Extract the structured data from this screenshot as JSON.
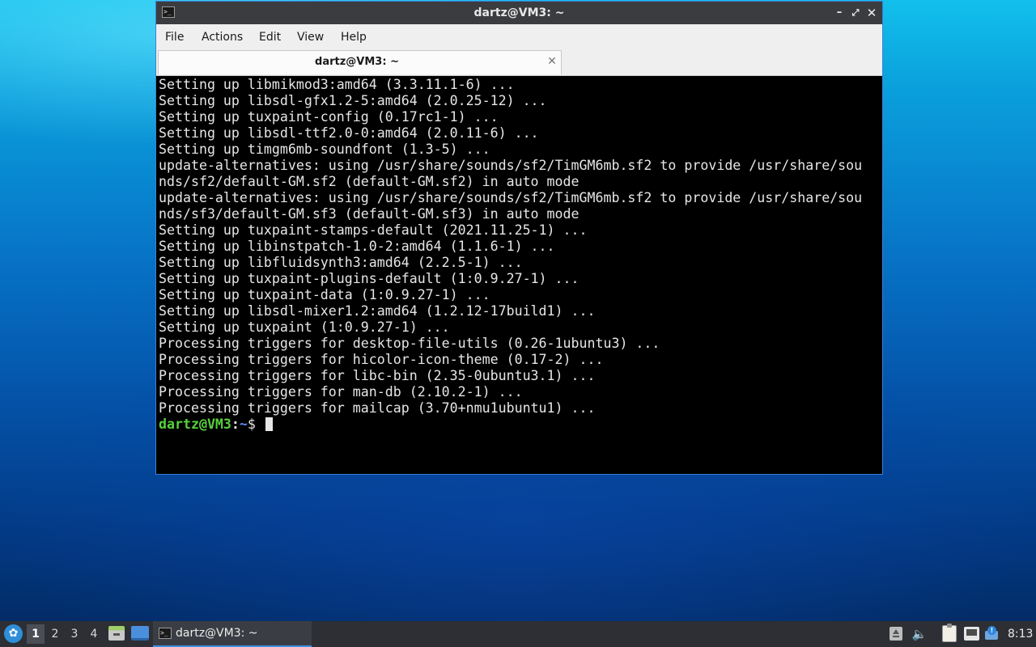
{
  "window": {
    "title": "dartz@VM3: ~",
    "controls": {
      "minimize": "minimize-icon",
      "maximize": "maximize-icon",
      "close": "close-icon"
    }
  },
  "menubar": {
    "items": [
      {
        "label": "File"
      },
      {
        "label": "Actions"
      },
      {
        "label": "Edit"
      },
      {
        "label": "View"
      },
      {
        "label": "Help"
      }
    ]
  },
  "tabs": [
    {
      "label": "dartz@VM3: ~",
      "active": true
    }
  ],
  "terminal": {
    "lines": [
      "Setting up libmikmod3:amd64 (3.3.11.1-6) ...",
      "Setting up libsdl-gfx1.2-5:amd64 (2.0.25-12) ...",
      "Setting up tuxpaint-config (0.17rc1-1) ...",
      "Setting up libsdl-ttf2.0-0:amd64 (2.0.11-6) ...",
      "Setting up timgm6mb-soundfont (1.3-5) ...",
      "update-alternatives: using /usr/share/sounds/sf2/TimGM6mb.sf2 to provide /usr/share/sou",
      "nds/sf2/default-GM.sf2 (default-GM.sf2) in auto mode",
      "update-alternatives: using /usr/share/sounds/sf2/TimGM6mb.sf2 to provide /usr/share/sou",
      "nds/sf3/default-GM.sf3 (default-GM.sf3) in auto mode",
      "Setting up tuxpaint-stamps-default (2021.11.25-1) ...",
      "Setting up libinstpatch-1.0-2:amd64 (1.1.6-1) ...",
      "Setting up libfluidsynth3:amd64 (2.2.5-1) ...",
      "Setting up tuxpaint-plugins-default (1:0.9.27-1) ...",
      "Setting up tuxpaint-data (1:0.9.27-1) ...",
      "Setting up libsdl-mixer1.2:amd64 (1.2.12-17build1) ...",
      "Setting up tuxpaint (1:0.9.27-1) ...",
      "Processing triggers for desktop-file-utils (0.26-1ubuntu3) ...",
      "Processing triggers for hicolor-icon-theme (0.17-2) ...",
      "Processing triggers for libc-bin (2.35-0ubuntu3.1) ...",
      "Processing triggers for man-db (2.10.2-1) ...",
      "Processing triggers for mailcap (3.70+nmu1ubuntu1) ..."
    ],
    "prompt": {
      "user_host": "dartz@VM3",
      "separator": ":",
      "path": "~",
      "symbol": "$ "
    },
    "colors": {
      "background": "#000000",
      "text": "#e6e6e6",
      "user": "#57d13d",
      "path": "#5a8cf0"
    }
  },
  "taskbar": {
    "workspaces": [
      "1",
      "2",
      "3",
      "4"
    ],
    "active_workspace": "1",
    "task_label": "dartz@VM3: ~",
    "clock": "8:13",
    "accent": "#3d8de0"
  }
}
